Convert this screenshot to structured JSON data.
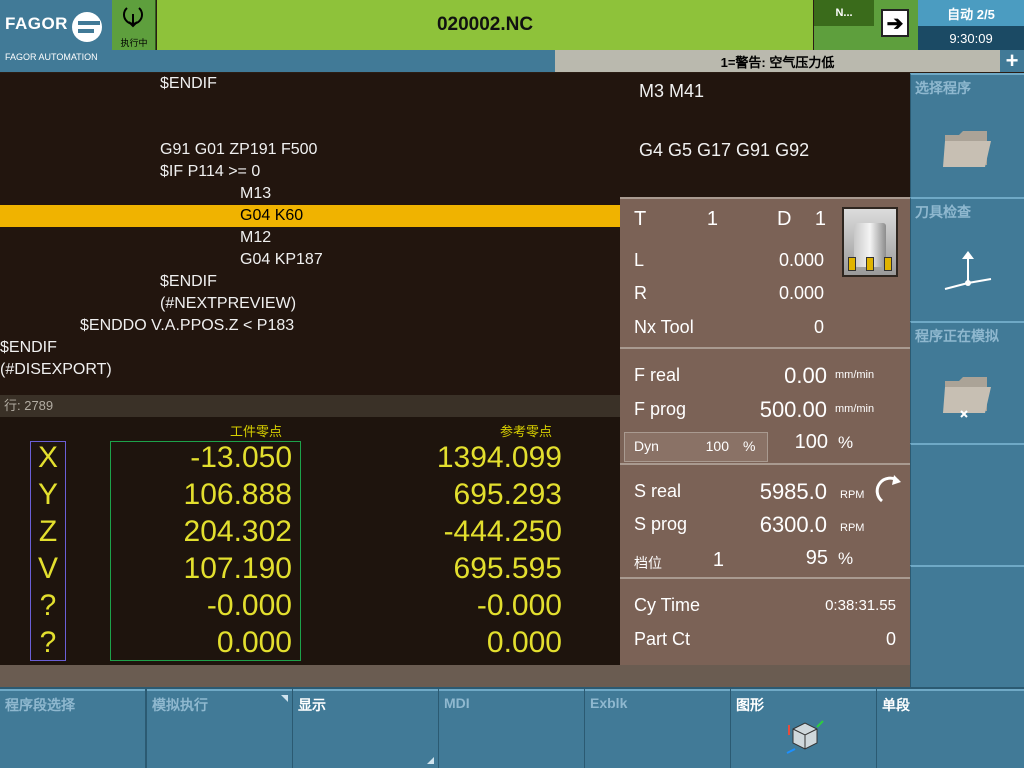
{
  "header": {
    "brand": "FAGOR",
    "brand_sub": "FAGOR AUTOMATION",
    "status_text": "执行中",
    "program_name": "020002.NC",
    "n_indicator": "N...",
    "mode": "自动 2/5",
    "clock": "9:30:09",
    "warning": "1=警告: 空气压力低",
    "plus": "+",
    "nav_arrow": "➔"
  },
  "program": {
    "lines": [
      "$ENDIF",
      "",
      "",
      "G91 G01 ZP191 F500",
      "$IF P114 >= 0",
      "M13",
      "G04 K60",
      "M12",
      "G04 KP187",
      "$ENDIF",
      "(#NEXTPREVIEW)",
      "$ENDDO V.A.PPOS.Z < P183",
      "$ENDIF",
      "(#DISEXPORT)"
    ],
    "line_info": "行: 2789"
  },
  "coords": {
    "work_header": "工件零点",
    "machine_header": "参考零点",
    "axes": [
      "X",
      "Y",
      "Z",
      "V",
      "?",
      "?"
    ],
    "work": [
      "-13.050",
      "106.888",
      "204.302",
      "107.190",
      "-0.000",
      "0.000"
    ],
    "machine": [
      "1394.099",
      "695.293",
      "-444.250",
      "695.595",
      "-0.000",
      "0.000"
    ]
  },
  "active_codes": {
    "line1": "M3 M41",
    "line2": "G4 G5 G17 G91 G92"
  },
  "tool": {
    "t_label": "T",
    "t_value": "1",
    "d_label": "D",
    "d_value": "1",
    "l_label": "L",
    "l_value": "0.000",
    "r_label": "R",
    "r_value": "0.000",
    "nx_label": "Nx Tool",
    "nx_value": "0"
  },
  "feed": {
    "freal_label": "F real",
    "freal_value": "0.00",
    "fprog_label": "F prog",
    "fprog_value": "500.00",
    "unit": "mm/min",
    "dyn_label": "Dyn",
    "dyn_value": "100",
    "dyn_unit": "%",
    "override_value": "100",
    "override_unit": "%"
  },
  "spindle": {
    "sreal_label": "S real",
    "sreal_value": "5985.0",
    "sprog_label": "S prog",
    "sprog_value": "6300.0",
    "unit": "RPM",
    "gear_label": "档位",
    "gear_value": "1",
    "override_value": "95",
    "override_unit": "%"
  },
  "times": {
    "cy_label": "Cy Time",
    "cy_value": "0:38:31.55",
    "part_label": "Part Ct",
    "part_value": "0"
  },
  "right_keys": [
    "选择程序",
    "刀具检查",
    "程序正在模拟",
    "",
    ""
  ],
  "bottom_keys": [
    "程序段选择",
    "模拟执行",
    "显示",
    "MDI",
    "Exblk",
    "图形",
    "单段"
  ],
  "colors": {
    "highlight": "#f0b300",
    "coord_text": "#e3df2e",
    "header_green": "#8ec23a",
    "softkey_blue": "#417a97"
  }
}
